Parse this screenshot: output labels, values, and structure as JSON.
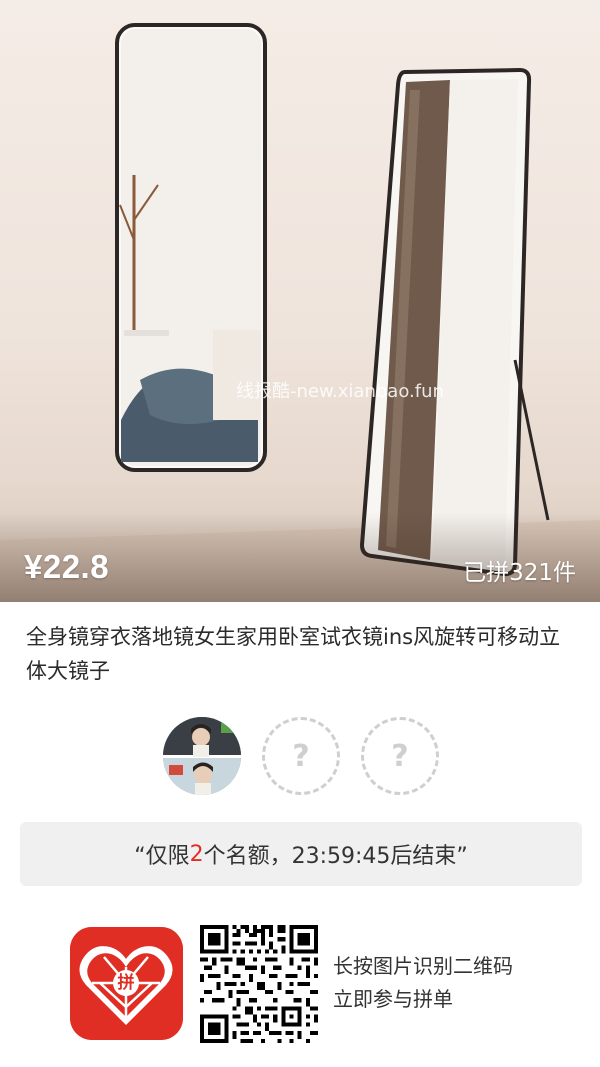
{
  "product": {
    "price": "¥22.8",
    "sold_count": "已拼321件",
    "watermark": "线报酷-new.xianbao.fun",
    "title": "全身镜穿衣落地镜女生家用卧室试衣镜ins风旋转可移动立体大镜子"
  },
  "group": {
    "placeholder_mark": "?"
  },
  "quota": {
    "prefix": "“仅限",
    "count": "2",
    "suffix": "个名额，23:59:45后结束”"
  },
  "share": {
    "hint_line1": "长按图片识别二维码",
    "hint_line2": "立即参与拼单",
    "logo_text": "拼"
  },
  "colors": {
    "accent": "#e02e24",
    "quota_bg": "#f0f0f0"
  }
}
